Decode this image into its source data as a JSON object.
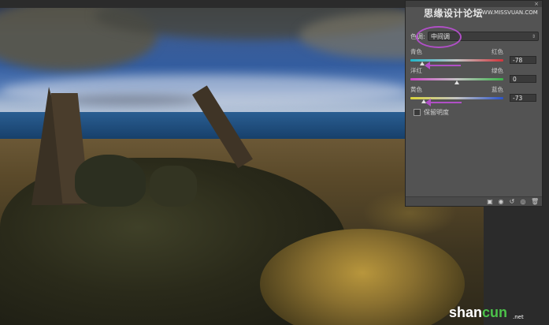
{
  "watermark": {
    "text": "思缘设计论坛",
    "url": "WWW.MISSVUAN.COM"
  },
  "panel": {
    "close_icon": "×",
    "tone": {
      "label": "色调:",
      "value": "中间调"
    },
    "sliders": [
      {
        "left": "青色",
        "right": "红色",
        "value": "-78",
        "level": 0.13
      },
      {
        "left": "洋红",
        "right": "绿色",
        "value": "0",
        "level": 0.5
      },
      {
        "left": "黄色",
        "right": "蓝色",
        "value": "-73",
        "level": 0.14
      }
    ],
    "preserve_luminosity": "保留明度",
    "footer_icons": [
      "clip-layer-icon",
      "eye-icon",
      "reset-icon",
      "visibility-icon",
      "trash-icon"
    ]
  },
  "logo": {
    "main": "shan",
    "accent": "cun",
    "sub": ".net"
  },
  "colors": {
    "annotation": "#b04fc6",
    "panel": "#535353"
  }
}
